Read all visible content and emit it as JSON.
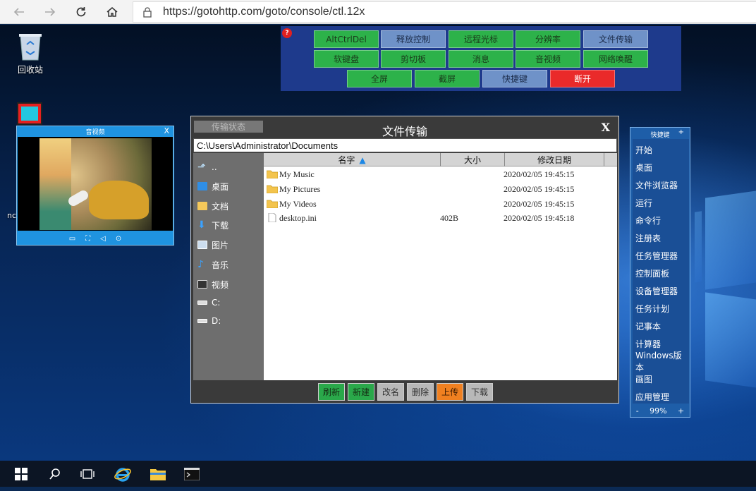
{
  "browser": {
    "url": "https://gotohttp.com/goto/console/ctl.12x",
    "back_icon": "arrow-left-icon",
    "forward_icon": "arrow-right-icon",
    "reload_icon": "reload-icon",
    "home_icon": "home-icon"
  },
  "desktop": {
    "recycle_bin_label": "回收站",
    "partial_label": "nc"
  },
  "control_panel": {
    "help": "?",
    "row1": [
      "AltCtrlDel",
      "释放控制",
      "远程光标",
      "分辨率",
      "文件传输"
    ],
    "row2": [
      "软键盘",
      "剪切板",
      "消息",
      "音视频",
      "网络唤醒"
    ],
    "row3": [
      "全屏",
      "截屏",
      "快捷键",
      "断开"
    ]
  },
  "av_window": {
    "title": "音视频",
    "close": "X"
  },
  "file_transfer": {
    "status_tab": "传输状态",
    "title": "文件传输",
    "close": "X",
    "path": "C:\\Users\\Administrator\\Documents",
    "sidebar": [
      "..",
      "桌面",
      "文档",
      "下载",
      "图片",
      "音乐",
      "视频",
      "C:",
      "D:"
    ],
    "columns": {
      "name": "名字",
      "size": "大小",
      "modified": "修改日期"
    },
    "files": [
      {
        "name": "My Music",
        "size": "",
        "modified": "2020/02/05 19:45:15",
        "type": "folder"
      },
      {
        "name": "My Pictures",
        "size": "",
        "modified": "2020/02/05 19:45:15",
        "type": "folder"
      },
      {
        "name": "My Videos",
        "size": "",
        "modified": "2020/02/05 19:45:15",
        "type": "folder"
      },
      {
        "name": "desktop.ini",
        "size": "402B",
        "modified": "2020/02/05 19:45:18",
        "type": "file"
      }
    ],
    "buttons": [
      "刷新",
      "新建",
      "改名",
      "删除",
      "上传",
      "下载"
    ]
  },
  "shortcut_panel": {
    "title": "快捷键",
    "plus": "+",
    "items": [
      "开始",
      "桌面",
      "文件浏览器",
      "运行",
      "命令行",
      "注册表",
      "任务管理器",
      "控制面板",
      "设备管理器",
      "任务计划",
      "记事本",
      "计算器",
      "Windows版本",
      "画图",
      "应用管理"
    ],
    "zoom_minus": "-",
    "zoom": "99%",
    "zoom_plus": "+"
  },
  "colors": {
    "green_button": "#2db24a",
    "blue_button": "#6f92c8",
    "red_button": "#ea2a2a",
    "orange_button": "#f08020",
    "panel_blue": "#1e3a8c"
  }
}
